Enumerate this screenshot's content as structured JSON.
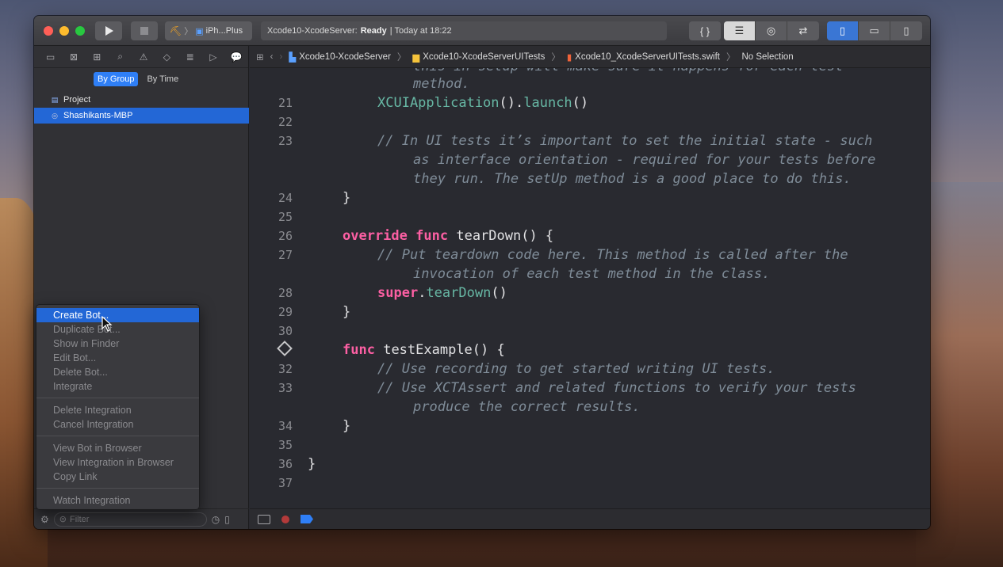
{
  "toolbar": {
    "scheme_label": "iPh...Plus",
    "activity_project": "Xcode10-XcodeServer:",
    "activity_status": "Ready",
    "activity_time": "| Today at 18:22",
    "code_toggle": "{ }"
  },
  "navigator": {
    "group_toggle": {
      "by_group": "By Group",
      "by_time": "By Time"
    },
    "rows": [
      {
        "label": "Project",
        "selected": false
      },
      {
        "label": "Shashikants-MBP",
        "selected": true
      }
    ],
    "filter_placeholder": "Filter"
  },
  "context_menu": {
    "groups": [
      [
        "Create Bot...",
        "Duplicate Bot...",
        "Show in Finder",
        "Edit Bot...",
        "Delete Bot...",
        "Integrate"
      ],
      [
        "Delete Integration",
        "Cancel Integration"
      ],
      [
        "View Bot in Browser",
        "View Integration in Browser",
        "Copy Link"
      ],
      [
        "Watch Integration"
      ]
    ],
    "highlighted": "Create Bot..."
  },
  "jumpbar": {
    "crumbs": [
      "Xcode10-XcodeServer",
      "Xcode10-XcodeServerUITests",
      "Xcode10_XcodeServerUITests.swift",
      "No Selection"
    ]
  },
  "editor": {
    "line_numbers": [
      "21",
      "22",
      "23",
      "24",
      "25",
      "26",
      "27",
      "28",
      "29",
      "30",
      "32",
      "33",
      "34",
      "35",
      "36",
      "37"
    ],
    "lines": {
      "l20_partial": "this in setup will make sure it happens for each test",
      "l20_b": "method.",
      "l21_fn": "XCUIApplication",
      "l21_rest": "().",
      "l21_fn2": "launch",
      "l21_end": "()",
      "l23_a": "// In UI tests it’s important to set the initial state - such",
      "l23_b": "as interface orientation - required for your tests before",
      "l23_c": "they run. The setUp method is a good place to do this.",
      "close_brace": "}",
      "l26_kw1": "override",
      "l26_kw2": "func",
      "l26_name": "tearDown() {",
      "l27_a": "// Put teardown code here. This method is called after the",
      "l27_b": "invocation of each test method in the class.",
      "l28_kw": "super",
      "l28_dot": ".",
      "l28_fn": "tearDown",
      "l28_end": "()",
      "l31_kw": "func",
      "l31_name": "testExample() {",
      "l32": "// Use recording to get started writing UI tests.",
      "l33_a": "// Use XCTAssert and related functions to verify your tests",
      "l33_b": "produce the correct results."
    }
  }
}
